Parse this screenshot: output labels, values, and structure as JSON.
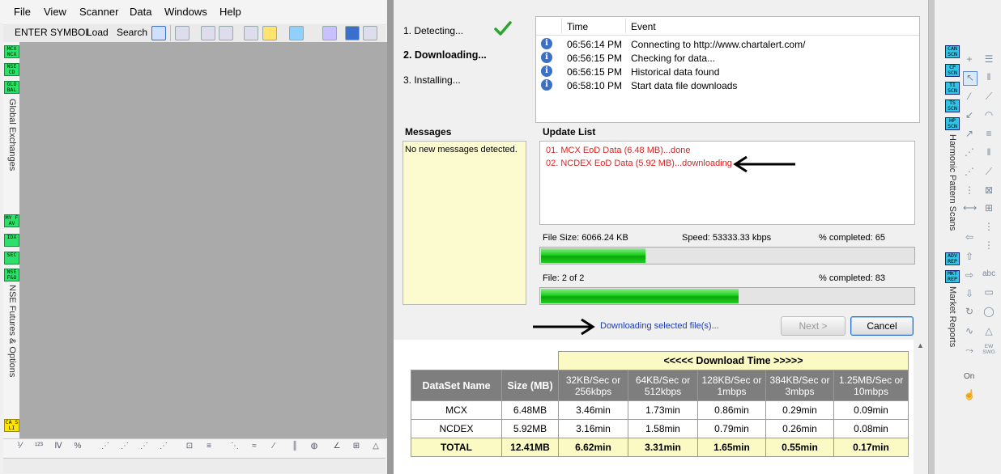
{
  "left_app": {
    "menu": [
      "File",
      "View",
      "Scanner",
      "Data",
      "Windows",
      "Help"
    ],
    "toolbar": {
      "symbol_label": "ENTER SYMBOL",
      "load_label": "Load",
      "search_label": "Search"
    },
    "left_buttons": [
      "MCX NCX",
      "NSE CD",
      "GLO BAL",
      "MY FAV",
      "IDX",
      "SEC",
      "NSE F&O",
      "CA SLI"
    ],
    "side_labels": {
      "global": "Global Exchanges",
      "futures": "NSE Futures & Options"
    }
  },
  "dialog": {
    "steps": [
      {
        "label": "1. Detecting...",
        "bold": false
      },
      {
        "label": "2. Downloading...",
        "bold": true
      },
      {
        "label": "3. Installing...",
        "bold": false
      }
    ],
    "event_log": {
      "col_time": "Time",
      "col_event": "Event",
      "rows": [
        {
          "time": "06:56:14 PM",
          "event": "Connecting to http://www.chartalert.com/"
        },
        {
          "time": "06:56:15 PM",
          "event": "Checking for data..."
        },
        {
          "time": "06:56:15 PM",
          "event": "Historical data found"
        },
        {
          "time": "06:58:10 PM",
          "event": "Start data file downloads"
        }
      ]
    },
    "messages": {
      "title": "Messages",
      "text": "No new messages detected."
    },
    "update_list": {
      "title": "Update List",
      "items": [
        "01. MCX EoD Data (6.48 MB)...done",
        "02. NCDEX EoD Data (5.92 MB)...downloading"
      ]
    },
    "file_size": "File Size: 6066.24 KB",
    "speed": "Speed: 53333.33 kbps",
    "completed_1": "% completed: 65",
    "progress_1": 0.28,
    "file_count": "File: 2 of 2",
    "completed_2": "% completed: 83",
    "progress_2": 0.53,
    "status_text": "Downloading selected file(s)...",
    "next_label": "Next >",
    "cancel_label": "Cancel"
  },
  "download_table": {
    "banner": "<<<<< Download Time >>>>>",
    "headers": [
      "DataSet Name",
      "Size (MB)",
      "32KB/Sec or 256kbps",
      "64KB/Sec or 512kbps",
      "128KB/Sec or 1mbps",
      "384KB/Sec or 3mbps",
      "1.25MB/Sec or 10mbps"
    ],
    "rows": [
      [
        "MCX",
        "6.48MB",
        "3.46min",
        "1.73min",
        "0.86min",
        "0.29min",
        "0.09min"
      ],
      [
        "NCDEX",
        "5.92MB",
        "3.16min",
        "1.58min",
        "0.79min",
        "0.26min",
        "0.08min"
      ]
    ],
    "total": [
      "TOTAL",
      "12.41MB",
      "6.62min",
      "3.31min",
      "1.65min",
      "0.55min",
      "0.17min"
    ]
  },
  "right_app": {
    "buttons_top": [
      "CAN SCN",
      "CP SCN",
      "TI SCN",
      "TS SCN",
      "HP SCN"
    ],
    "buttons_bottom": [
      "ADV REP",
      "MKT REP"
    ],
    "side_labels": {
      "harmonic": "Harmonic Pattern Scans",
      "market": "Market Reports"
    },
    "tool_labels": [
      "abc",
      "On",
      "EW SWG"
    ]
  },
  "colors": {
    "progress": "#1bd21b",
    "update_text": "#dd2222",
    "status_text": "#1a3db5",
    "table_header": "#7e7e7e",
    "table_highlight": "#fbfac4"
  }
}
